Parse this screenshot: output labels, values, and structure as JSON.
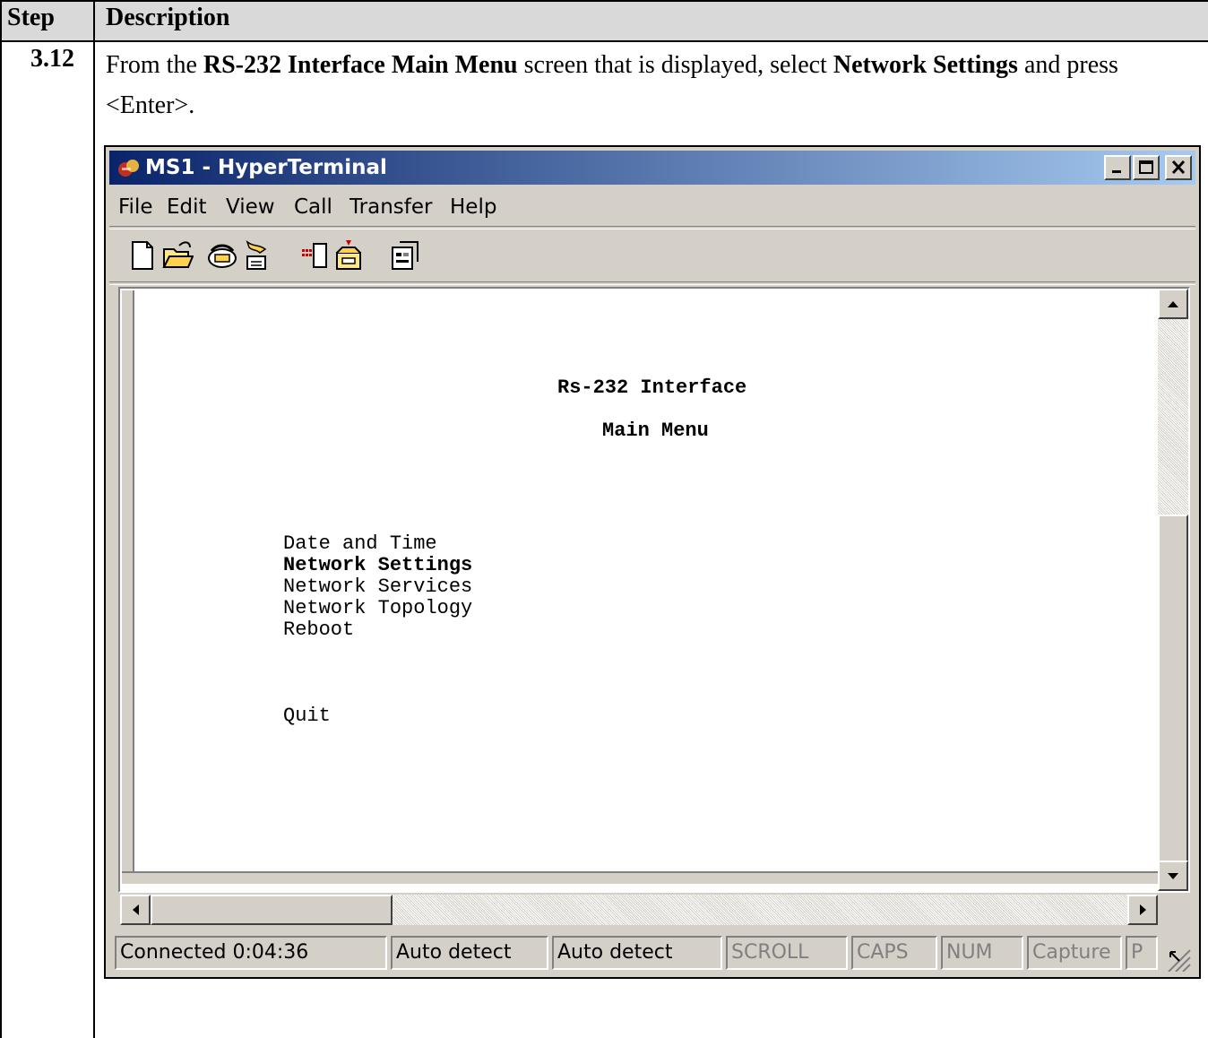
{
  "table": {
    "header_step": "Step",
    "header_description": "Description",
    "step_number": "3.12",
    "desc_part1": "From the ",
    "desc_bold1": "RS-232 Interface Main Menu",
    "desc_part2": " screen that is displayed, select ",
    "desc_bold2": "Network Settings",
    "desc_part3": " and press <Enter>."
  },
  "window": {
    "title": "MS1 - HyperTerminal",
    "menu": [
      "File",
      "Edit",
      "View",
      "Call",
      "Transfer",
      "Help"
    ],
    "toolbar_icons": [
      "new-icon",
      "open-icon",
      "connect-icon",
      "disconnect-icon",
      "send-icon",
      "receive-icon",
      "properties-icon"
    ]
  },
  "terminal": {
    "heading": "Rs-232 Interface",
    "subheading": "Main Menu",
    "items": [
      "Date and Time",
      "Network Settings",
      "Network Services",
      "Network Topology",
      "Reboot"
    ],
    "quit": "Quit"
  },
  "status": {
    "connected": "Connected 0:04:36",
    "detect1": "Auto detect",
    "detect2": "Auto detect",
    "scroll": "SCROLL",
    "caps": "CAPS",
    "num": "NUM",
    "capture": "Capture",
    "print": "P"
  }
}
